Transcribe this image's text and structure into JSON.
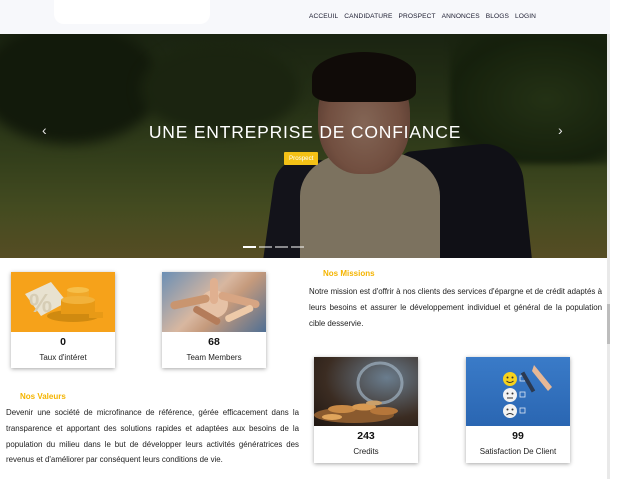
{
  "nav": {
    "items": [
      "ACCEUIL",
      "CANDIDATURE",
      "PROSPECT",
      "ANNONCES",
      "BLOGS",
      "LOGIN"
    ]
  },
  "hero": {
    "title": "UNE ENTREPRISE DE CONFIANCE",
    "button_label": "Prospect",
    "prev_icon": "chevron-left-icon",
    "next_icon": "chevron-right-icon",
    "prev_glyph": "‹",
    "next_glyph": "›",
    "slides_count": 4,
    "active_slide": 1,
    "accent": "#f4c116"
  },
  "stats": {
    "taux": {
      "value": "0",
      "label": "Taux d'intéret"
    },
    "team": {
      "value": "68",
      "label": "Team Members"
    },
    "credits": {
      "value": "243",
      "label": "Credits"
    },
    "satisfaction": {
      "value": "99",
      "label": "Satisfaction De Client"
    }
  },
  "missions": {
    "title": "Nos Missions",
    "text": "Notre mission est d'offrir à nos clients des services d'épargne et de crédit adaptés à leurs besoins et assurer le développement individuel et général de la population cible desservie."
  },
  "valeurs": {
    "title": "Nos Valeurs",
    "text": "Devenir une société de microfinance de référence, gérée efficacement dans la transparence et apportant des solutions rapides et adaptées aux besoins de la population du milieu dans le but de développer leurs activités génératrices des revenus et d'améliorer par conséquent leurs conditions de vie."
  },
  "colors": {
    "section_title": "#f4b400",
    "nav_bg": "#f7f8fb"
  }
}
